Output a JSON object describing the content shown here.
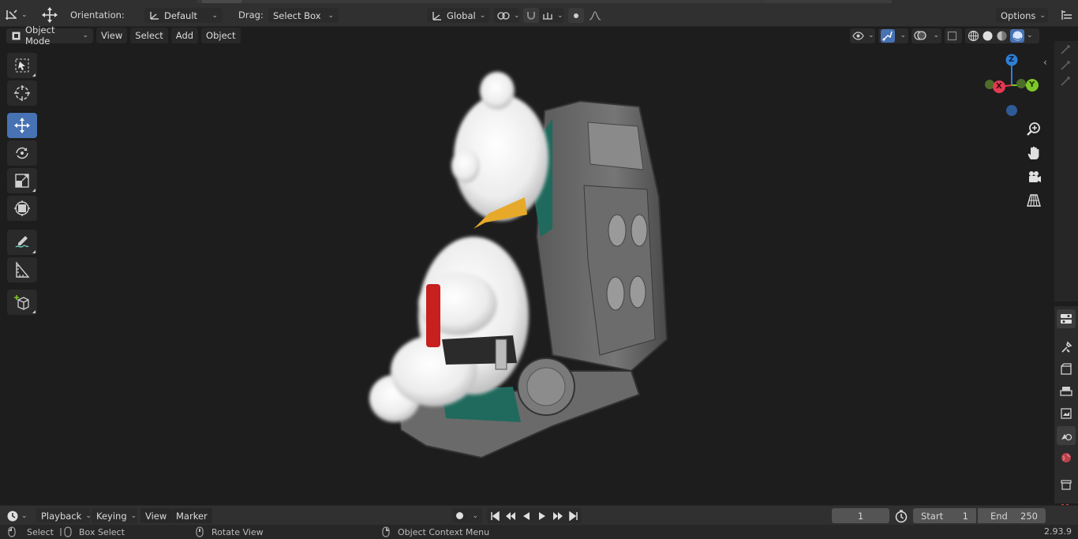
{
  "header": {
    "orientation_label": "Orientation:",
    "orientation_value": "Default",
    "drag_label": "Drag:",
    "drag_value": "Select Box",
    "transform_orientation": "Global",
    "options_label": "Options"
  },
  "viewport_header": {
    "mode": "Object Mode",
    "menus": [
      "View",
      "Select",
      "Add",
      "Object"
    ]
  },
  "gizmo": {
    "z": "Z",
    "x": "X",
    "y": "Y"
  },
  "timeline": {
    "menus": [
      "Playback",
      "Keying",
      "View",
      "Marker"
    ],
    "current_frame": "1",
    "start_label": "Start",
    "start_value": "1",
    "end_label": "End",
    "end_value": "250"
  },
  "statusbar": {
    "select": "Select",
    "box_select": "Box Select",
    "rotate_view": "Rotate View",
    "context_menu": "Object Context Menu",
    "version": "2.93.9"
  },
  "colors": {
    "accent": "#4772b3",
    "axis_x": "#e33a52",
    "axis_y": "#7ec72a",
    "axis_z": "#2f7fd6",
    "viewport_bg": "#1d1d1d",
    "header_bg": "#303030"
  }
}
